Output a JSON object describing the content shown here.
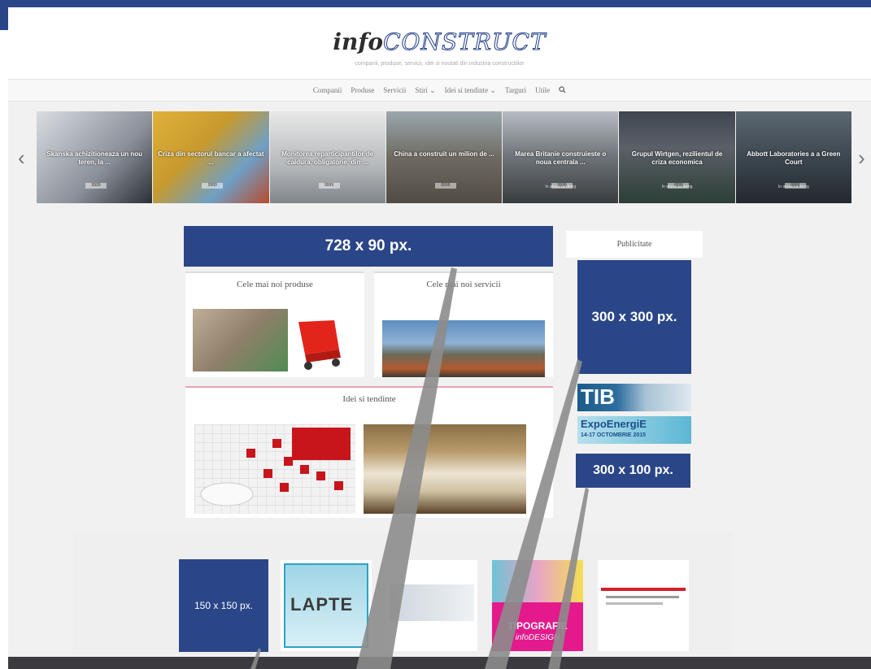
{
  "header": {
    "logo_info": "info",
    "logo_construct": "CONSTRUCT",
    "tagline": "companii, produse, servicii, idei si noutati din industria constructiilor"
  },
  "nav": {
    "items": [
      "Companii",
      "Produse",
      "Servicii",
      "Stiri",
      "Idei si tendinte",
      "Targuri",
      "Utile"
    ]
  },
  "slider": {
    "slides": [
      {
        "title": "Skanska achizitioneaza un nou teren, la ...",
        "meta": "",
        "badge": "9999"
      },
      {
        "title": "Criza din sectorul bancar a afectat ...",
        "meta": "",
        "badge": "9999"
      },
      {
        "title": "Monitorea reparticipantilor de caldura, obligatorie, din ...",
        "meta": "",
        "badge": "9999"
      },
      {
        "title": "China a construit un milion de ...",
        "meta": "",
        "badge": "9999"
      },
      {
        "title": "Marea Britanie construieste o noua centrala ...",
        "meta": "In atasa cu desig",
        "badge": "9999"
      },
      {
        "title": "Grupul Wirtgen, rezilientul de criza economica",
        "meta": "In atasa cu desig",
        "badge": "9999"
      },
      {
        "title": "Abbott Laboratories a a Green Court",
        "meta": "In atasa cu desig",
        "badge": "9999"
      }
    ]
  },
  "banners": {
    "leaderboard": "728 x 90 px.",
    "square": "300 x 300 px.",
    "wide": "300 x 100 px.",
    "small": "150 x 150 px."
  },
  "cards": {
    "products": "Cele mai noi produse",
    "services": "Cele mai noi servicii",
    "ideas": "Idei si tendinte"
  },
  "sidebar": {
    "pub_title": "Publicitate",
    "ad1": "TIB",
    "ad2": "ExpoEnergiE",
    "ad2_sub": "14-17 OCTOMBRIE 2015"
  },
  "partners": {
    "lapte": "LAPTE",
    "tipografie": "TIPOGRAFIE",
    "tipografie_brand": "infoDESIGN"
  },
  "colors": {
    "accent": "#2a4688",
    "footer": "#3b3b3f"
  }
}
